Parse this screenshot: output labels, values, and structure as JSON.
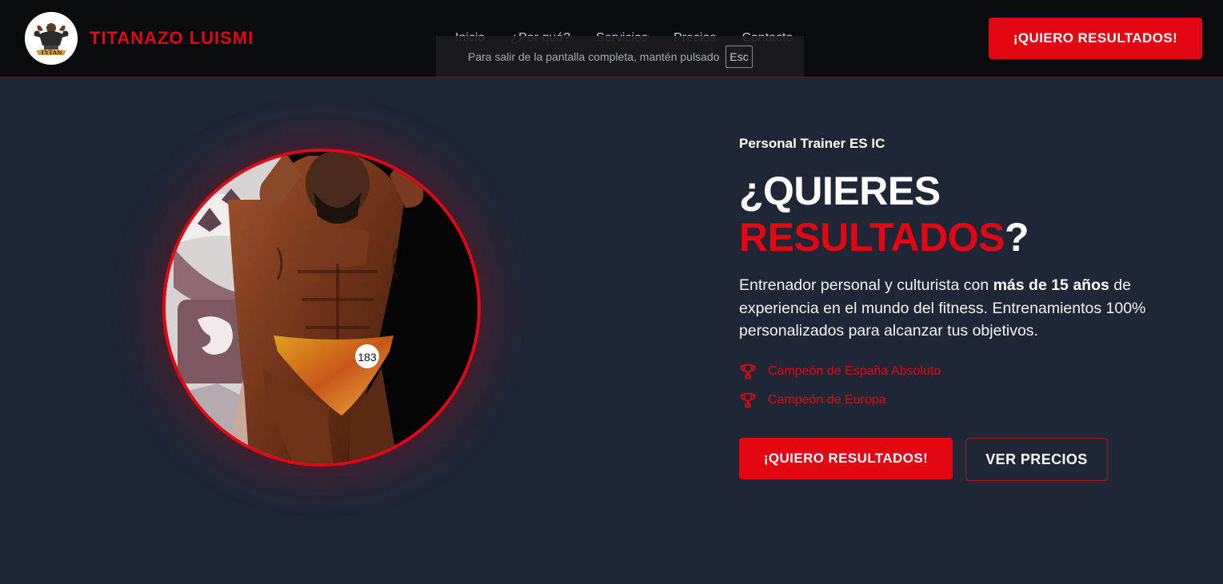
{
  "brand": {
    "name": "TITANAZO LUISMI",
    "logo_text": "TYTAN"
  },
  "nav": {
    "links": [
      "Inicio",
      "¿Por qué?",
      "Servicios",
      "Precios",
      "Contacto"
    ],
    "cta_label": "¡QUIERO RESULTADOS!"
  },
  "fullscreen_notice": {
    "text": "Para salir de la pantalla completa, mantén pulsado",
    "key": "Esc"
  },
  "hero": {
    "subtitle": "Personal Trainer ES IC",
    "headline_line1": "¿QUIERES",
    "headline_red": "RESULTADOS",
    "headline_end": "?",
    "desc_part1": "Entrenador personal y culturista con ",
    "desc_bold": "más de 15 años",
    "desc_part2": " de experiencia en el mundo del fitness. Entrenamientos 100% personalizados para alcanzar tus objetivos.",
    "awards": [
      "Campeón de España Absoluto",
      "Campeón de Europa"
    ],
    "primary_button": "¡QUIERO RESULTADOS!",
    "secondary_button": "VER PRECIOS",
    "bib_number": "183"
  },
  "colors": {
    "accent": "#e30613",
    "navbar_bg": "#0a0b0f",
    "page_bg": "#1f2737"
  },
  "icons": {
    "award_icon": "trophy-icon"
  }
}
